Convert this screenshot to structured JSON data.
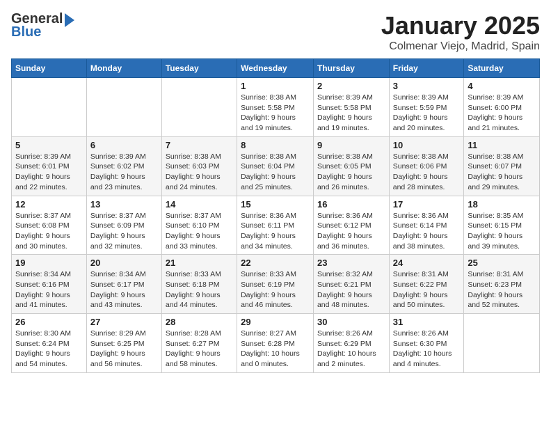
{
  "header": {
    "logo_general": "General",
    "logo_blue": "Blue",
    "month": "January 2025",
    "location": "Colmenar Viejo, Madrid, Spain"
  },
  "days_of_week": [
    "Sunday",
    "Monday",
    "Tuesday",
    "Wednesday",
    "Thursday",
    "Friday",
    "Saturday"
  ],
  "weeks": [
    [
      {
        "day": "",
        "info": ""
      },
      {
        "day": "",
        "info": ""
      },
      {
        "day": "",
        "info": ""
      },
      {
        "day": "1",
        "info": "Sunrise: 8:38 AM\nSunset: 5:58 PM\nDaylight: 9 hours\nand 19 minutes."
      },
      {
        "day": "2",
        "info": "Sunrise: 8:39 AM\nSunset: 5:58 PM\nDaylight: 9 hours\nand 19 minutes."
      },
      {
        "day": "3",
        "info": "Sunrise: 8:39 AM\nSunset: 5:59 PM\nDaylight: 9 hours\nand 20 minutes."
      },
      {
        "day": "4",
        "info": "Sunrise: 8:39 AM\nSunset: 6:00 PM\nDaylight: 9 hours\nand 21 minutes."
      }
    ],
    [
      {
        "day": "5",
        "info": "Sunrise: 8:39 AM\nSunset: 6:01 PM\nDaylight: 9 hours\nand 22 minutes."
      },
      {
        "day": "6",
        "info": "Sunrise: 8:39 AM\nSunset: 6:02 PM\nDaylight: 9 hours\nand 23 minutes."
      },
      {
        "day": "7",
        "info": "Sunrise: 8:38 AM\nSunset: 6:03 PM\nDaylight: 9 hours\nand 24 minutes."
      },
      {
        "day": "8",
        "info": "Sunrise: 8:38 AM\nSunset: 6:04 PM\nDaylight: 9 hours\nand 25 minutes."
      },
      {
        "day": "9",
        "info": "Sunrise: 8:38 AM\nSunset: 6:05 PM\nDaylight: 9 hours\nand 26 minutes."
      },
      {
        "day": "10",
        "info": "Sunrise: 8:38 AM\nSunset: 6:06 PM\nDaylight: 9 hours\nand 28 minutes."
      },
      {
        "day": "11",
        "info": "Sunrise: 8:38 AM\nSunset: 6:07 PM\nDaylight: 9 hours\nand 29 minutes."
      }
    ],
    [
      {
        "day": "12",
        "info": "Sunrise: 8:37 AM\nSunset: 6:08 PM\nDaylight: 9 hours\nand 30 minutes."
      },
      {
        "day": "13",
        "info": "Sunrise: 8:37 AM\nSunset: 6:09 PM\nDaylight: 9 hours\nand 32 minutes."
      },
      {
        "day": "14",
        "info": "Sunrise: 8:37 AM\nSunset: 6:10 PM\nDaylight: 9 hours\nand 33 minutes."
      },
      {
        "day": "15",
        "info": "Sunrise: 8:36 AM\nSunset: 6:11 PM\nDaylight: 9 hours\nand 34 minutes."
      },
      {
        "day": "16",
        "info": "Sunrise: 8:36 AM\nSunset: 6:12 PM\nDaylight: 9 hours\nand 36 minutes."
      },
      {
        "day": "17",
        "info": "Sunrise: 8:36 AM\nSunset: 6:14 PM\nDaylight: 9 hours\nand 38 minutes."
      },
      {
        "day": "18",
        "info": "Sunrise: 8:35 AM\nSunset: 6:15 PM\nDaylight: 9 hours\nand 39 minutes."
      }
    ],
    [
      {
        "day": "19",
        "info": "Sunrise: 8:34 AM\nSunset: 6:16 PM\nDaylight: 9 hours\nand 41 minutes."
      },
      {
        "day": "20",
        "info": "Sunrise: 8:34 AM\nSunset: 6:17 PM\nDaylight: 9 hours\nand 43 minutes."
      },
      {
        "day": "21",
        "info": "Sunrise: 8:33 AM\nSunset: 6:18 PM\nDaylight: 9 hours\nand 44 minutes."
      },
      {
        "day": "22",
        "info": "Sunrise: 8:33 AM\nSunset: 6:19 PM\nDaylight: 9 hours\nand 46 minutes."
      },
      {
        "day": "23",
        "info": "Sunrise: 8:32 AM\nSunset: 6:21 PM\nDaylight: 9 hours\nand 48 minutes."
      },
      {
        "day": "24",
        "info": "Sunrise: 8:31 AM\nSunset: 6:22 PM\nDaylight: 9 hours\nand 50 minutes."
      },
      {
        "day": "25",
        "info": "Sunrise: 8:31 AM\nSunset: 6:23 PM\nDaylight: 9 hours\nand 52 minutes."
      }
    ],
    [
      {
        "day": "26",
        "info": "Sunrise: 8:30 AM\nSunset: 6:24 PM\nDaylight: 9 hours\nand 54 minutes."
      },
      {
        "day": "27",
        "info": "Sunrise: 8:29 AM\nSunset: 6:25 PM\nDaylight: 9 hours\nand 56 minutes."
      },
      {
        "day": "28",
        "info": "Sunrise: 8:28 AM\nSunset: 6:27 PM\nDaylight: 9 hours\nand 58 minutes."
      },
      {
        "day": "29",
        "info": "Sunrise: 8:27 AM\nSunset: 6:28 PM\nDaylight: 10 hours\nand 0 minutes."
      },
      {
        "day": "30",
        "info": "Sunrise: 8:26 AM\nSunset: 6:29 PM\nDaylight: 10 hours\nand 2 minutes."
      },
      {
        "day": "31",
        "info": "Sunrise: 8:26 AM\nSunset: 6:30 PM\nDaylight: 10 hours\nand 4 minutes."
      },
      {
        "day": "",
        "info": ""
      }
    ]
  ]
}
